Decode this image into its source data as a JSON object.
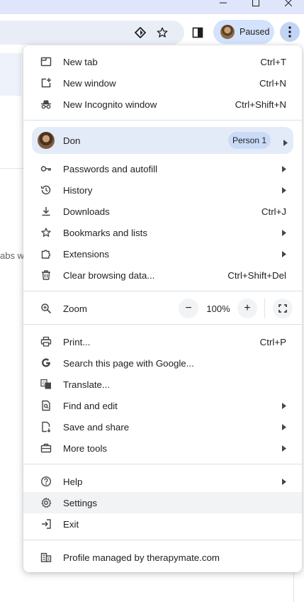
{
  "toolbar": {
    "profile_status": "Paused",
    "tab_search_text": "abs wi"
  },
  "menu": {
    "new_tab": {
      "label": "New tab",
      "shortcut": "Ctrl+T"
    },
    "new_window": {
      "label": "New window",
      "shortcut": "Ctrl+N"
    },
    "new_incognito": {
      "label": "New Incognito window",
      "shortcut": "Ctrl+Shift+N"
    },
    "profile": {
      "name": "Don",
      "badge": "Person 1"
    },
    "passwords": {
      "label": "Passwords and autofill"
    },
    "history": {
      "label": "History"
    },
    "downloads": {
      "label": "Downloads",
      "shortcut": "Ctrl+J"
    },
    "bookmarks": {
      "label": "Bookmarks and lists"
    },
    "extensions": {
      "label": "Extensions"
    },
    "clear_data": {
      "label": "Clear browsing data...",
      "shortcut": "Ctrl+Shift+Del"
    },
    "zoom": {
      "label": "Zoom",
      "minus": "−",
      "value": "100%",
      "plus": "+"
    },
    "print": {
      "label": "Print...",
      "shortcut": "Ctrl+P"
    },
    "search_page": {
      "label": "Search this page with Google..."
    },
    "translate": {
      "label": "Translate..."
    },
    "find_edit": {
      "label": "Find and edit"
    },
    "save_share": {
      "label": "Save and share"
    },
    "more_tools": {
      "label": "More tools"
    },
    "help": {
      "label": "Help"
    },
    "settings": {
      "label": "Settings"
    },
    "exit": {
      "label": "Exit"
    },
    "managed": {
      "label": "Profile managed by therapymate.com"
    }
  }
}
